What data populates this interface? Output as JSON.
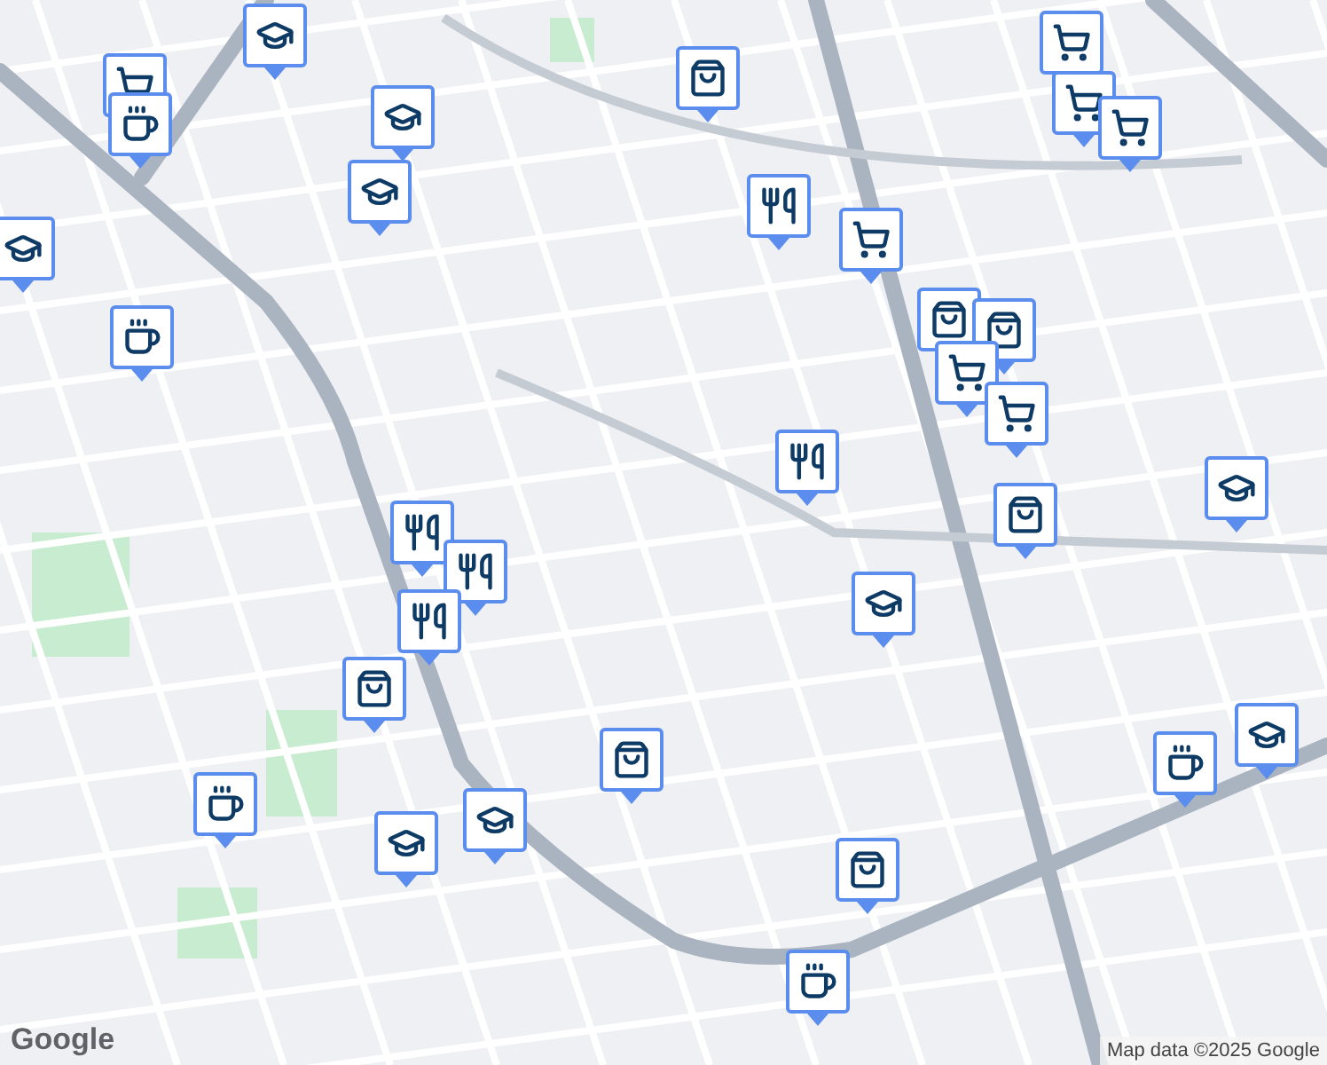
{
  "map": {
    "markers": [
      {
        "kind": "cap"
      },
      {
        "kind": "cart"
      },
      {
        "kind": "coffee"
      },
      {
        "kind": "cap"
      },
      {
        "kind": "cap"
      },
      {
        "kind": "cap"
      },
      {
        "kind": "coffee"
      },
      {
        "kind": "bag"
      },
      {
        "kind": "food"
      },
      {
        "kind": "cart"
      },
      {
        "kind": "cart"
      },
      {
        "kind": "cart"
      },
      {
        "kind": "cart"
      },
      {
        "kind": "bag"
      },
      {
        "kind": "bag"
      },
      {
        "kind": "cart"
      },
      {
        "kind": "cart"
      },
      {
        "kind": "food"
      },
      {
        "kind": "cap"
      },
      {
        "kind": "bag"
      },
      {
        "kind": "cap"
      },
      {
        "kind": "food"
      },
      {
        "kind": "food"
      },
      {
        "kind": "food"
      },
      {
        "kind": "bag"
      },
      {
        "kind": "bag"
      },
      {
        "kind": "coffee"
      },
      {
        "kind": "cap"
      },
      {
        "kind": "cap"
      },
      {
        "kind": "bag"
      },
      {
        "kind": "coffee"
      },
      {
        "kind": "cap"
      },
      {
        "kind": "coffee"
      }
    ]
  },
  "logo": "Google",
  "attribution": "Map data ©2025 Google"
}
